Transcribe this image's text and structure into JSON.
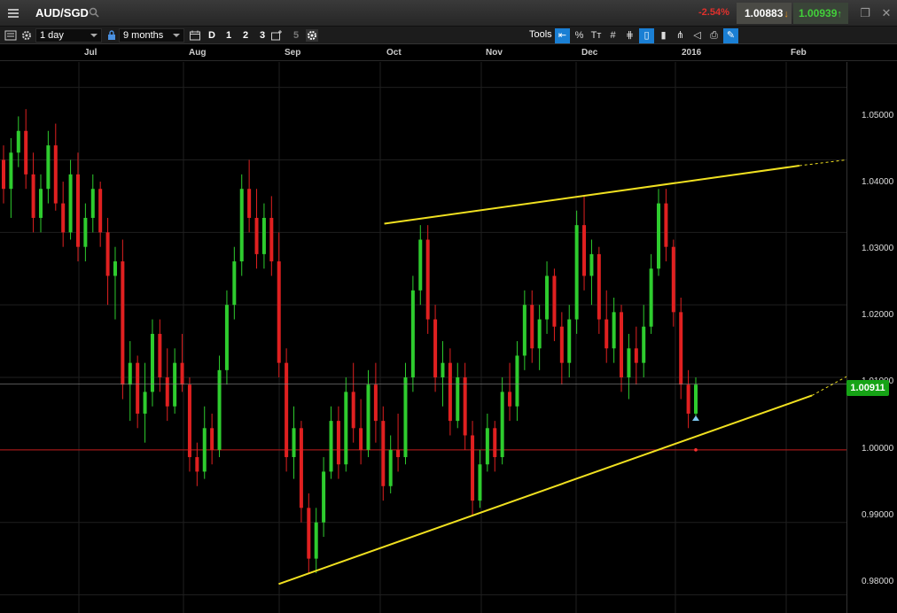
{
  "header": {
    "symbol": "AUD/SGD",
    "change": "-2.54%",
    "sell_price": "1.00883",
    "buy_price": "1.00939"
  },
  "toolbar": {
    "interval": "1 day",
    "range": "9 months",
    "periods": [
      "D",
      "1",
      "2",
      "3"
    ],
    "compare_count": "5",
    "tools_label": "Tools",
    "tool_percent": "%",
    "tool_text": "Tт"
  },
  "chart_data": {
    "type": "candlestick",
    "instrument": "AUD/SGD",
    "interval": "1 day",
    "x_axis_labels": [
      "Jul",
      "Aug",
      "Sep",
      "Oct",
      "Nov",
      "Dec",
      "2016",
      "Feb"
    ],
    "y_axis_labels": [
      "1.05000",
      "1.04000",
      "1.03000",
      "1.02000",
      "1.01000",
      "1.00000",
      "0.99000",
      "0.98000"
    ],
    "ylim": [
      0.9775,
      1.0535
    ],
    "current_price": "1.00911",
    "current_price_value": 1.00911,
    "reference_level": 1.0,
    "colors": {
      "up": "#2ecc2e",
      "down": "#e02020",
      "trendline": "#f0e020",
      "price_tag": "#16a316",
      "ref_line": "#c01818"
    },
    "candles_ohlc": [
      [
        1.04,
        1.042,
        1.034,
        1.036
      ],
      [
        1.036,
        1.043,
        1.032,
        1.041
      ],
      [
        1.041,
        1.046,
        1.039,
        1.044
      ],
      [
        1.044,
        1.047,
        1.036,
        1.038
      ],
      [
        1.038,
        1.041,
        1.03,
        1.032
      ],
      [
        1.032,
        1.038,
        1.03,
        1.036
      ],
      [
        1.036,
        1.044,
        1.034,
        1.042
      ],
      [
        1.042,
        1.045,
        1.033,
        1.034
      ],
      [
        1.034,
        1.037,
        1.028,
        1.03
      ],
      [
        1.03,
        1.04,
        1.029,
        1.038
      ],
      [
        1.038,
        1.041,
        1.026,
        1.028
      ],
      [
        1.028,
        1.034,
        1.026,
        1.032
      ],
      [
        1.032,
        1.038,
        1.03,
        1.036
      ],
      [
        1.036,
        1.037,
        1.028,
        1.03
      ],
      [
        1.03,
        1.032,
        1.02,
        1.024
      ],
      [
        1.024,
        1.028,
        1.018,
        1.026
      ],
      [
        1.026,
        1.029,
        1.007,
        1.009
      ],
      [
        1.009,
        1.015,
        1.004,
        1.012
      ],
      [
        1.012,
        1.013,
        1.003,
        1.005
      ],
      [
        1.005,
        1.012,
        1.001,
        1.008
      ],
      [
        1.008,
        1.018,
        1.006,
        1.016
      ],
      [
        1.016,
        1.018,
        1.008,
        1.01
      ],
      [
        1.01,
        1.014,
        1.004,
        1.006
      ],
      [
        1.006,
        1.014,
        1.005,
        1.012
      ],
      [
        1.012,
        1.016,
        1.008,
        1.009
      ],
      [
        1.009,
        1.01,
        0.997,
        0.999
      ],
      [
        0.999,
        1.001,
        0.995,
        0.997
      ],
      [
        0.997,
        1.006,
        0.996,
        1.003
      ],
      [
        1.003,
        1.005,
        0.998,
        1.0
      ],
      [
        1.0,
        1.013,
        0.999,
        1.011
      ],
      [
        1.011,
        1.022,
        1.009,
        1.02
      ],
      [
        1.02,
        1.028,
        1.018,
        1.026
      ],
      [
        1.026,
        1.038,
        1.024,
        1.036
      ],
      [
        1.036,
        1.04,
        1.03,
        1.032
      ],
      [
        1.032,
        1.036,
        1.025,
        1.027
      ],
      [
        1.027,
        1.034,
        1.025,
        1.032
      ],
      [
        1.032,
        1.035,
        1.024,
        1.026
      ],
      [
        1.026,
        1.03,
        1.01,
        1.012
      ],
      [
        1.012,
        1.014,
        0.997,
        0.999
      ],
      [
        0.999,
        1.006,
        0.996,
        1.003
      ],
      [
        1.003,
        1.004,
        0.99,
        0.992
      ],
      [
        0.992,
        0.994,
        0.983,
        0.985
      ],
      [
        0.985,
        0.992,
        0.983,
        0.99
      ],
      [
        0.99,
        0.999,
        0.988,
        0.997
      ],
      [
        0.997,
        1.006,
        0.996,
        1.004
      ],
      [
        1.004,
        1.006,
        0.996,
        0.998
      ],
      [
        0.998,
        1.01,
        0.997,
        1.008
      ],
      [
        1.008,
        1.012,
        1.001,
        1.003
      ],
      [
        1.003,
        1.007,
        0.998,
        1.0
      ],
      [
        1.0,
        1.011,
        0.999,
        1.009
      ],
      [
        1.009,
        1.012,
        1.001,
        1.004
      ],
      [
        1.004,
        1.006,
        0.993,
        0.995
      ],
      [
        0.995,
        1.002,
        0.994,
        1.0
      ],
      [
        1.0,
        1.005,
        0.997,
        0.999
      ],
      [
        0.999,
        1.012,
        0.998,
        1.01
      ],
      [
        1.01,
        1.024,
        1.008,
        1.022
      ],
      [
        1.022,
        1.031,
        1.02,
        1.029
      ],
      [
        1.029,
        1.031,
        1.016,
        1.018
      ],
      [
        1.018,
        1.02,
        1.008,
        1.01
      ],
      [
        1.01,
        1.015,
        1.006,
        1.012
      ],
      [
        1.012,
        1.014,
        1.002,
        1.004
      ],
      [
        1.004,
        1.012,
        1.003,
        1.01
      ],
      [
        1.01,
        1.012,
        1.0,
        1.002
      ],
      [
        1.002,
        1.004,
        0.991,
        0.993
      ],
      [
        0.993,
        1.0,
        0.992,
        0.998
      ],
      [
        0.998,
        1.005,
        0.997,
        1.003
      ],
      [
        1.003,
        1.004,
        0.997,
        0.999
      ],
      [
        0.999,
        1.01,
        0.998,
        1.008
      ],
      [
        1.008,
        1.012,
        1.004,
        1.006
      ],
      [
        1.006,
        1.015,
        1.004,
        1.013
      ],
      [
        1.013,
        1.022,
        1.011,
        1.02
      ],
      [
        1.02,
        1.022,
        1.012,
        1.014
      ],
      [
        1.014,
        1.02,
        1.011,
        1.018
      ],
      [
        1.018,
        1.026,
        1.016,
        1.024
      ],
      [
        1.024,
        1.025,
        1.015,
        1.017
      ],
      [
        1.017,
        1.019,
        1.009,
        1.012
      ],
      [
        1.012,
        1.02,
        1.01,
        1.018
      ],
      [
        1.018,
        1.033,
        1.016,
        1.031
      ],
      [
        1.031,
        1.035,
        1.022,
        1.024
      ],
      [
        1.024,
        1.029,
        1.02,
        1.027
      ],
      [
        1.027,
        1.028,
        1.016,
        1.018
      ],
      [
        1.018,
        1.022,
        1.012,
        1.014
      ],
      [
        1.014,
        1.021,
        1.012,
        1.019
      ],
      [
        1.019,
        1.02,
        1.008,
        1.01
      ],
      [
        1.01,
        1.016,
        1.007,
        1.014
      ],
      [
        1.014,
        1.017,
        1.009,
        1.012
      ],
      [
        1.012,
        1.02,
        1.01,
        1.017
      ],
      [
        1.017,
        1.027,
        1.016,
        1.025
      ],
      [
        1.025,
        1.036,
        1.024,
        1.034
      ],
      [
        1.034,
        1.036,
        1.026,
        1.028
      ],
      [
        1.028,
        1.029,
        1.017,
        1.019
      ],
      [
        1.019,
        1.021,
        1.007,
        1.009
      ],
      [
        1.009,
        1.011,
        1.003,
        1.005
      ],
      [
        1.005,
        1.01,
        1.004,
        1.009
      ]
    ],
    "trendlines": [
      {
        "name": "resistance",
        "from": [
          0.454,
          1.0312
        ],
        "to": [
          0.9443,
          1.0392
        ],
        "extension_to": [
          1.0,
          1.04
        ]
      },
      {
        "name": "support",
        "from": [
          0.3292,
          0.9815
        ],
        "to": [
          0.9592,
          1.0075
        ],
        "extension_to": [
          1.0,
          1.0101
        ]
      }
    ]
  }
}
